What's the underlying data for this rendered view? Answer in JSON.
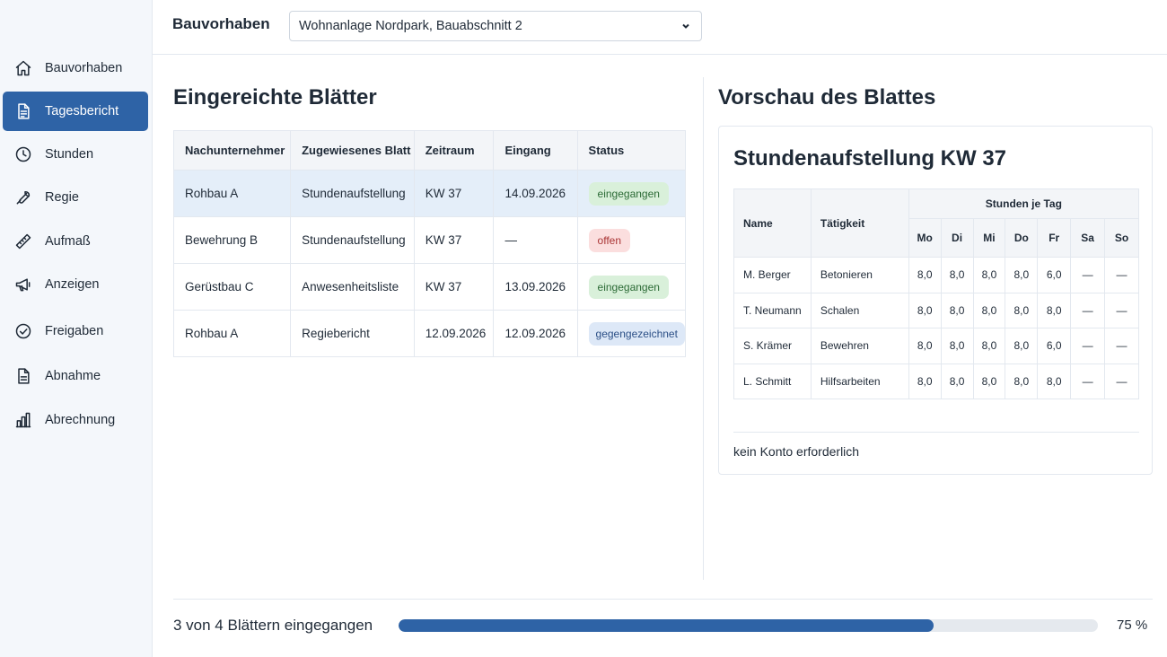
{
  "colors": {
    "accent": "#2e63a6",
    "received": "#d9f0da",
    "open": "#fbdede",
    "countersigned": "#dde8f7"
  },
  "sidebar": {
    "items": [
      {
        "label": "Bauvorhaben",
        "icon": "home-icon"
      },
      {
        "label": "Tagesbericht",
        "icon": "document-icon",
        "active": true
      },
      {
        "label": "Stunden",
        "icon": "clock-icon"
      },
      {
        "label": "Regie",
        "icon": "wrench-icon"
      },
      {
        "label": "Aufmaß",
        "icon": "ruler-icon"
      },
      {
        "label": "Anzeigen",
        "icon": "megaphone-icon"
      },
      {
        "label": "Freigaben",
        "icon": "check-circle-icon"
      },
      {
        "label": "Abnahme",
        "icon": "file-icon"
      },
      {
        "label": "Abrechnung",
        "icon": "bar-chart-icon"
      }
    ]
  },
  "header": {
    "label": "Bauvorhaben",
    "project": "Wohnanlage Nordpark, Bauabschnitt 2"
  },
  "sheets": {
    "title": "Eingereichte Blätter",
    "columns": [
      "Nachunternehmer",
      "Zugewiesenes Blatt",
      "Zeitraum",
      "Eingang",
      "Status"
    ],
    "rows": [
      {
        "contractor": "Rohbau A",
        "sheet": "Stundenaufstellung",
        "period": "KW 37",
        "received": "14.09.2026",
        "status": "eingegangen",
        "selected": true
      },
      {
        "contractor": "Bewehrung B",
        "sheet": "Stundenaufstellung",
        "period": "KW 37",
        "received": "—",
        "status": "offen"
      },
      {
        "contractor": "Gerüstbau C",
        "sheet": "Anwesenheitsliste",
        "period": "KW 37",
        "received": "13.09.2026",
        "status": "eingegangen"
      },
      {
        "contractor": "Rohbau A",
        "sheet": "Regiebericht",
        "period": "12.09.2026",
        "received": "12.09.2026",
        "status": "gegengezeichnet"
      }
    ]
  },
  "preview": {
    "title": "Vorschau des Blattes",
    "doc_title": "Stundenaufstellung KW 37",
    "col_name": "Name",
    "col_activity": "Tätigkeit",
    "col_group": "Stunden je Tag",
    "days": [
      "Mo",
      "Di",
      "Mi",
      "Do",
      "Fr",
      "Sa",
      "So"
    ],
    "rows": [
      {
        "name": "M. Berger",
        "activity": "Betonieren",
        "hours": [
          "8,0",
          "8,0",
          "8,0",
          "8,0",
          "6,0",
          "—",
          "—"
        ]
      },
      {
        "name": "T. Neumann",
        "activity": "Schalen",
        "hours": [
          "8,0",
          "8,0",
          "8,0",
          "8,0",
          "8,0",
          "—",
          "—"
        ]
      },
      {
        "name": "S. Krämer",
        "activity": "Bewehren",
        "hours": [
          "8,0",
          "8,0",
          "8,0",
          "8,0",
          "6,0",
          "—",
          "—"
        ]
      },
      {
        "name": "L. Schmitt",
        "activity": "Hilfsarbeiten",
        "hours": [
          "8,0",
          "8,0",
          "8,0",
          "8,0",
          "8,0",
          "—",
          "—"
        ]
      }
    ],
    "note": "kein Konto erforderlich"
  },
  "progress": {
    "text": "3 von 4 Blättern eingegangen",
    "value": 0.765,
    "percent_label": "75 %"
  }
}
